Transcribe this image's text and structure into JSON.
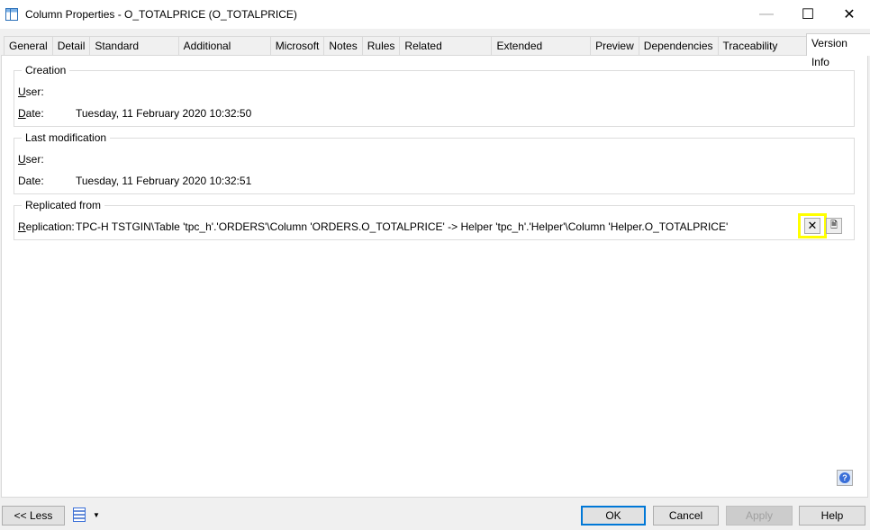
{
  "window": {
    "title": "Column Properties - O_TOTALPRICE (O_TOTALPRICE)"
  },
  "tabs": [
    "General",
    "Detail",
    "Standard Checks",
    "Additional Checks",
    "Microsoft",
    "Notes",
    "Rules",
    "Related Diagrams",
    "Extended Attributes",
    "Preview",
    "Dependencies",
    "Traceability Links",
    "Version Info"
  ],
  "active_tab": "Version Info",
  "creation": {
    "legend": "Creation",
    "user_label": "User:",
    "user_value": "",
    "date_label": "Date:",
    "date_value": "Tuesday, 11 February 2020 10:32:50"
  },
  "modification": {
    "legend": "Last modification",
    "user_label": "User:",
    "user_value": "",
    "date_label": "Date:",
    "date_value": "Tuesday, 11 February 2020 10:32:51"
  },
  "replication": {
    "legend": "Replicated from",
    "label": "Replication:",
    "value": "TPC-H TSTGIN\\Table 'tpc_h'.'ORDERS'\\Column 'ORDERS.O_TOTALPRICE' -> Helper 'tpc_h'.'Helper'\\Column 'Helper.O_TOTALPRICE'",
    "highlight_color": "#ffff00"
  },
  "footer": {
    "less": "<< Less",
    "ok": "OK",
    "cancel": "Cancel",
    "apply": "Apply",
    "help": "Help"
  }
}
